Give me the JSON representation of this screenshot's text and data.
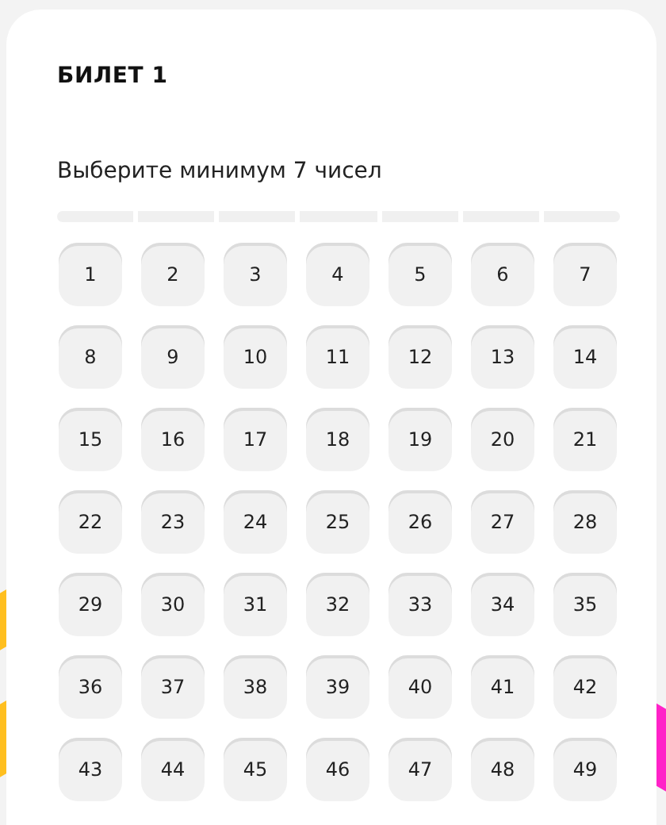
{
  "ticket": {
    "title": "БИЛЕТ 1",
    "instruction": "Выберите минимум 7 чисел",
    "progress": [
      {
        "filled": false
      },
      {
        "filled": false
      },
      {
        "filled": false
      },
      {
        "filled": false
      },
      {
        "filled": false
      },
      {
        "filled": false
      },
      {
        "filled": false
      }
    ],
    "numbers": [
      {
        "label": "1",
        "selected": false
      },
      {
        "label": "2",
        "selected": false
      },
      {
        "label": "3",
        "selected": false
      },
      {
        "label": "4",
        "selected": false
      },
      {
        "label": "5",
        "selected": false
      },
      {
        "label": "6",
        "selected": false
      },
      {
        "label": "7",
        "selected": false
      },
      {
        "label": "8",
        "selected": false
      },
      {
        "label": "9",
        "selected": false
      },
      {
        "label": "10",
        "selected": false
      },
      {
        "label": "11",
        "selected": false
      },
      {
        "label": "12",
        "selected": false
      },
      {
        "label": "13",
        "selected": false
      },
      {
        "label": "14",
        "selected": false
      },
      {
        "label": "15",
        "selected": false
      },
      {
        "label": "16",
        "selected": false
      },
      {
        "label": "17",
        "selected": false
      },
      {
        "label": "18",
        "selected": false
      },
      {
        "label": "19",
        "selected": false
      },
      {
        "label": "20",
        "selected": false
      },
      {
        "label": "21",
        "selected": false
      },
      {
        "label": "22",
        "selected": false
      },
      {
        "label": "23",
        "selected": false
      },
      {
        "label": "24",
        "selected": false
      },
      {
        "label": "25",
        "selected": false
      },
      {
        "label": "26",
        "selected": false
      },
      {
        "label": "27",
        "selected": false
      },
      {
        "label": "28",
        "selected": false
      },
      {
        "label": "29",
        "selected": false
      },
      {
        "label": "30",
        "selected": false
      },
      {
        "label": "31",
        "selected": false
      },
      {
        "label": "32",
        "selected": false
      },
      {
        "label": "33",
        "selected": false
      },
      {
        "label": "34",
        "selected": false
      },
      {
        "label": "35",
        "selected": false
      },
      {
        "label": "36",
        "selected": false
      },
      {
        "label": "37",
        "selected": false
      },
      {
        "label": "38",
        "selected": false
      },
      {
        "label": "39",
        "selected": false
      },
      {
        "label": "40",
        "selected": false
      },
      {
        "label": "41",
        "selected": false
      },
      {
        "label": "42",
        "selected": false
      },
      {
        "label": "43",
        "selected": false
      },
      {
        "label": "44",
        "selected": false
      },
      {
        "label": "45",
        "selected": false
      },
      {
        "label": "46",
        "selected": false
      },
      {
        "label": "47",
        "selected": false
      },
      {
        "label": "48",
        "selected": false
      },
      {
        "label": "49",
        "selected": false
      }
    ]
  }
}
